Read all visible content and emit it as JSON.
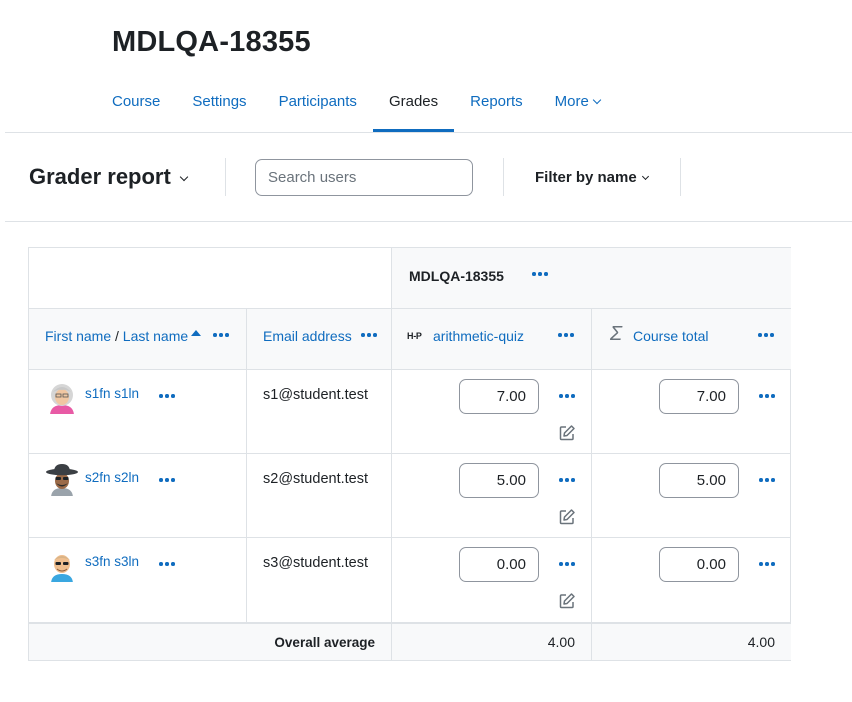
{
  "course": {
    "title": "MDLQA-18355"
  },
  "nav": {
    "items": [
      {
        "label": "Course"
      },
      {
        "label": "Settings"
      },
      {
        "label": "Participants"
      },
      {
        "label": "Grades"
      },
      {
        "label": "Reports"
      },
      {
        "label": "More"
      }
    ],
    "active": "Grades"
  },
  "toolbar": {
    "report_label": "Grader report",
    "search_placeholder": "Search users",
    "filter_label": "Filter by name"
  },
  "grader": {
    "category_header": "MDLQA-18355",
    "columns": {
      "first_name": "First name",
      "separator": "/",
      "last_name": "Last name",
      "email": "Email address",
      "quiz": "arithmetic-quiz",
      "quiz_icon_text": "H-P",
      "course_total": "Course total"
    },
    "rows": [
      {
        "name": "s1fn s1ln",
        "email": "s1@student.test",
        "quiz_grade": "7.00",
        "total_grade": "7.00"
      },
      {
        "name": "s2fn s2ln",
        "email": "s2@student.test",
        "quiz_grade": "5.00",
        "total_grade": "5.00"
      },
      {
        "name": "s3fn s3ln",
        "email": "s3@student.test",
        "quiz_grade": "0.00",
        "total_grade": "0.00"
      }
    ],
    "footer": {
      "label": "Overall average",
      "quiz_avg": "4.00",
      "total_avg": "4.00"
    }
  },
  "colors": {
    "link": "#0f6cbf",
    "text": "#1d2125",
    "border": "#dee2e6",
    "header_bg": "#f8f9fa"
  }
}
